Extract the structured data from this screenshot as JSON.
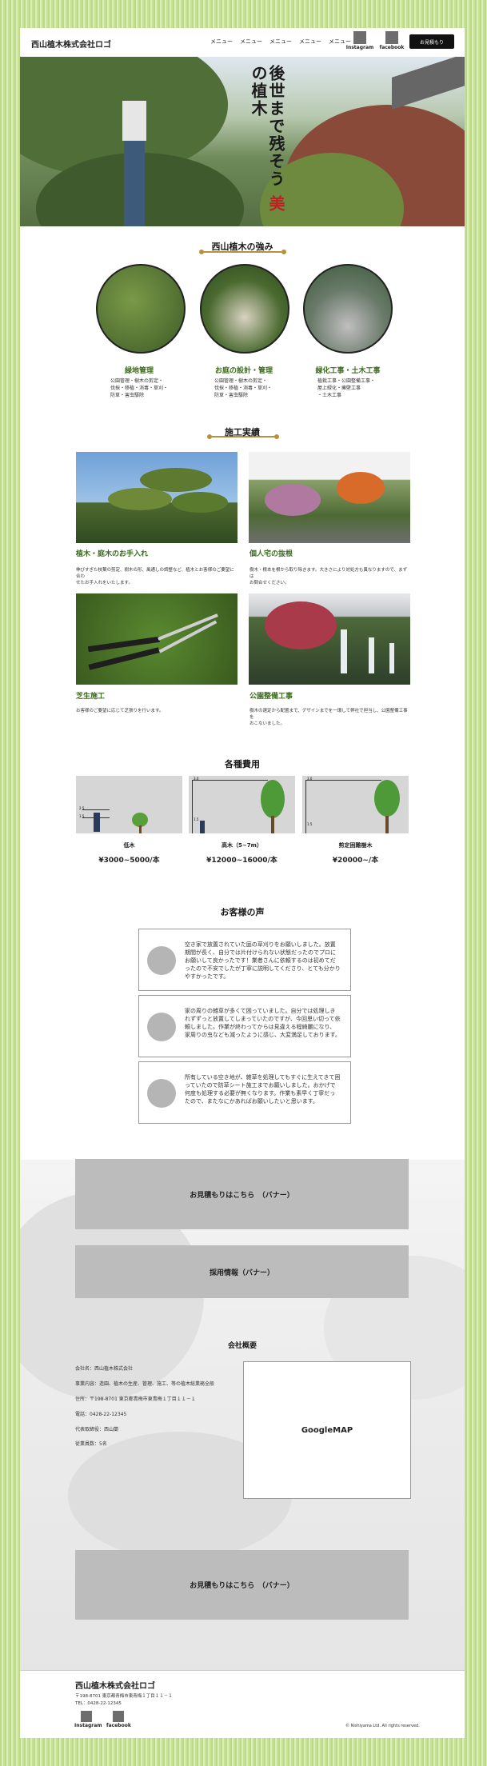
{
  "header": {
    "logo": "西山植木株式会社ロゴ",
    "nav": [
      "メニュー",
      "メニュー",
      "メニュー",
      "メニュー",
      "メニュー"
    ],
    "instagram": "Instagram",
    "facebook": "facebook",
    "contact": "お見積もり"
  },
  "hero": {
    "line1": "後世まで残そう",
    "line2_red": "美",
    "line2_rest": "の植木"
  },
  "strengths": {
    "title": "西山植木の強み",
    "items": [
      {
        "title": "緑地管理",
        "desc": [
          "公園管理・樹木の剪定・",
          "伐採・移植・消毒・草刈・",
          "防草・害虫駆除"
        ]
      },
      {
        "title": "お庭の設計・管理",
        "desc": [
          "公園管理・樹木の剪定・",
          "伐採・移植・消毒・草刈・",
          "防草・害虫駆除"
        ]
      },
      {
        "title": "緑化工事・土木工事",
        "desc": [
          "植栽工事・公園整備工事・",
          "屋上緑化・擁壁工事",
          "・土木工事"
        ]
      }
    ]
  },
  "works": {
    "title": "施工実績",
    "items": [
      {
        "title": "植木・庭木のお手入れ",
        "desc": [
          "伸びすぎた枝葉の剪定、樹木の形、風通しの調整など、植木とお客様のご要望に合わ",
          "せたお手入れをいたします。"
        ]
      },
      {
        "title": "個人宅の抜根",
        "desc": [
          "樹木・根本を根から取り除きます。大きさにより対処方も異なりますので、まずは",
          "お問合せください。"
        ]
      },
      {
        "title": "芝生施工",
        "desc": [
          "お客様のご要望に応じて芝張りを行います。"
        ]
      },
      {
        "title": "公園整備工事",
        "desc": [
          "樹木の選定から配置まで、デザインまでを一環して弊社で担当し、公園整備工事を",
          "おこないました。"
        ]
      }
    ]
  },
  "costs": {
    "title": "各種費用",
    "items": [
      {
        "name": "低木",
        "price": "¥3000~5000/本",
        "marks": [
          "2.5",
          "1.5"
        ]
      },
      {
        "name": "高木（5~7m）",
        "price": "¥12000~16000/本",
        "marks": [
          "3.0",
          "1.5"
        ]
      },
      {
        "name": "剪定困難樹木",
        "price": "¥20000~/本",
        "marks": [
          "3.0",
          "1.5"
        ]
      }
    ]
  },
  "voices": {
    "title": "お客様の声",
    "items": [
      {
        "text": "空き家で放置されていた庭の草刈りをお願いしました。放置期間が長く、自分では片付けられない状態だったのでプロにお願いして良かったです！業者さんに依頼するのは初めてだったので不安でしたが丁寧に説明してくださり、とても分かりやすかったです。"
      },
      {
        "text": "家の周りの雑草が多くて困っていました。自分では処理しきれずずっと放置してしまっていたのですが、今回思い切って依頼しました。作業が終わってからは見違える程綺麗になり、家周りの虫なども減ったように感じ、大変満足しております。"
      },
      {
        "text": "所有している空き地が、雑草を処理してもすぐに生えてきて困っていたので防草シート施工までお願いしました。おかげで何度も処理する必要が無くなります。作業も素早く丁寧だったので、またなにかあればお願いしたいと思います。"
      }
    ]
  },
  "banners": {
    "estimate": "お見積もりはこちら　（バナー）",
    "recruit": "採用情報（バナー）"
  },
  "company": {
    "title": "会社概要",
    "lines": [
      "会社名：西山植木株式会社",
      "事業内容：造園、植木の生産、管理、施工、等の植木総業務全般",
      "住所：〒198-8701 東京都青梅市東青梅１丁目１１－１",
      "電話：0428-22-12345",
      "代表取締役：西山蘭",
      "従業員数：5名"
    ],
    "map": "GoogleMAP"
  },
  "footer": {
    "logo": "西山植木株式会社ロゴ",
    "address": "〒198-8701 東京都青梅市東青梅１丁目１１－１",
    "tel": "TEL：0428-22-12345",
    "instagram": "Instagram",
    "facebook": "facebook",
    "copyright": "© Nishiyama Ltd. All rights reserved."
  },
  "colors": {
    "accent_gold": "#b8913f",
    "green_title": "#3d6b1e",
    "banner_gray": "#bcbcbc"
  }
}
